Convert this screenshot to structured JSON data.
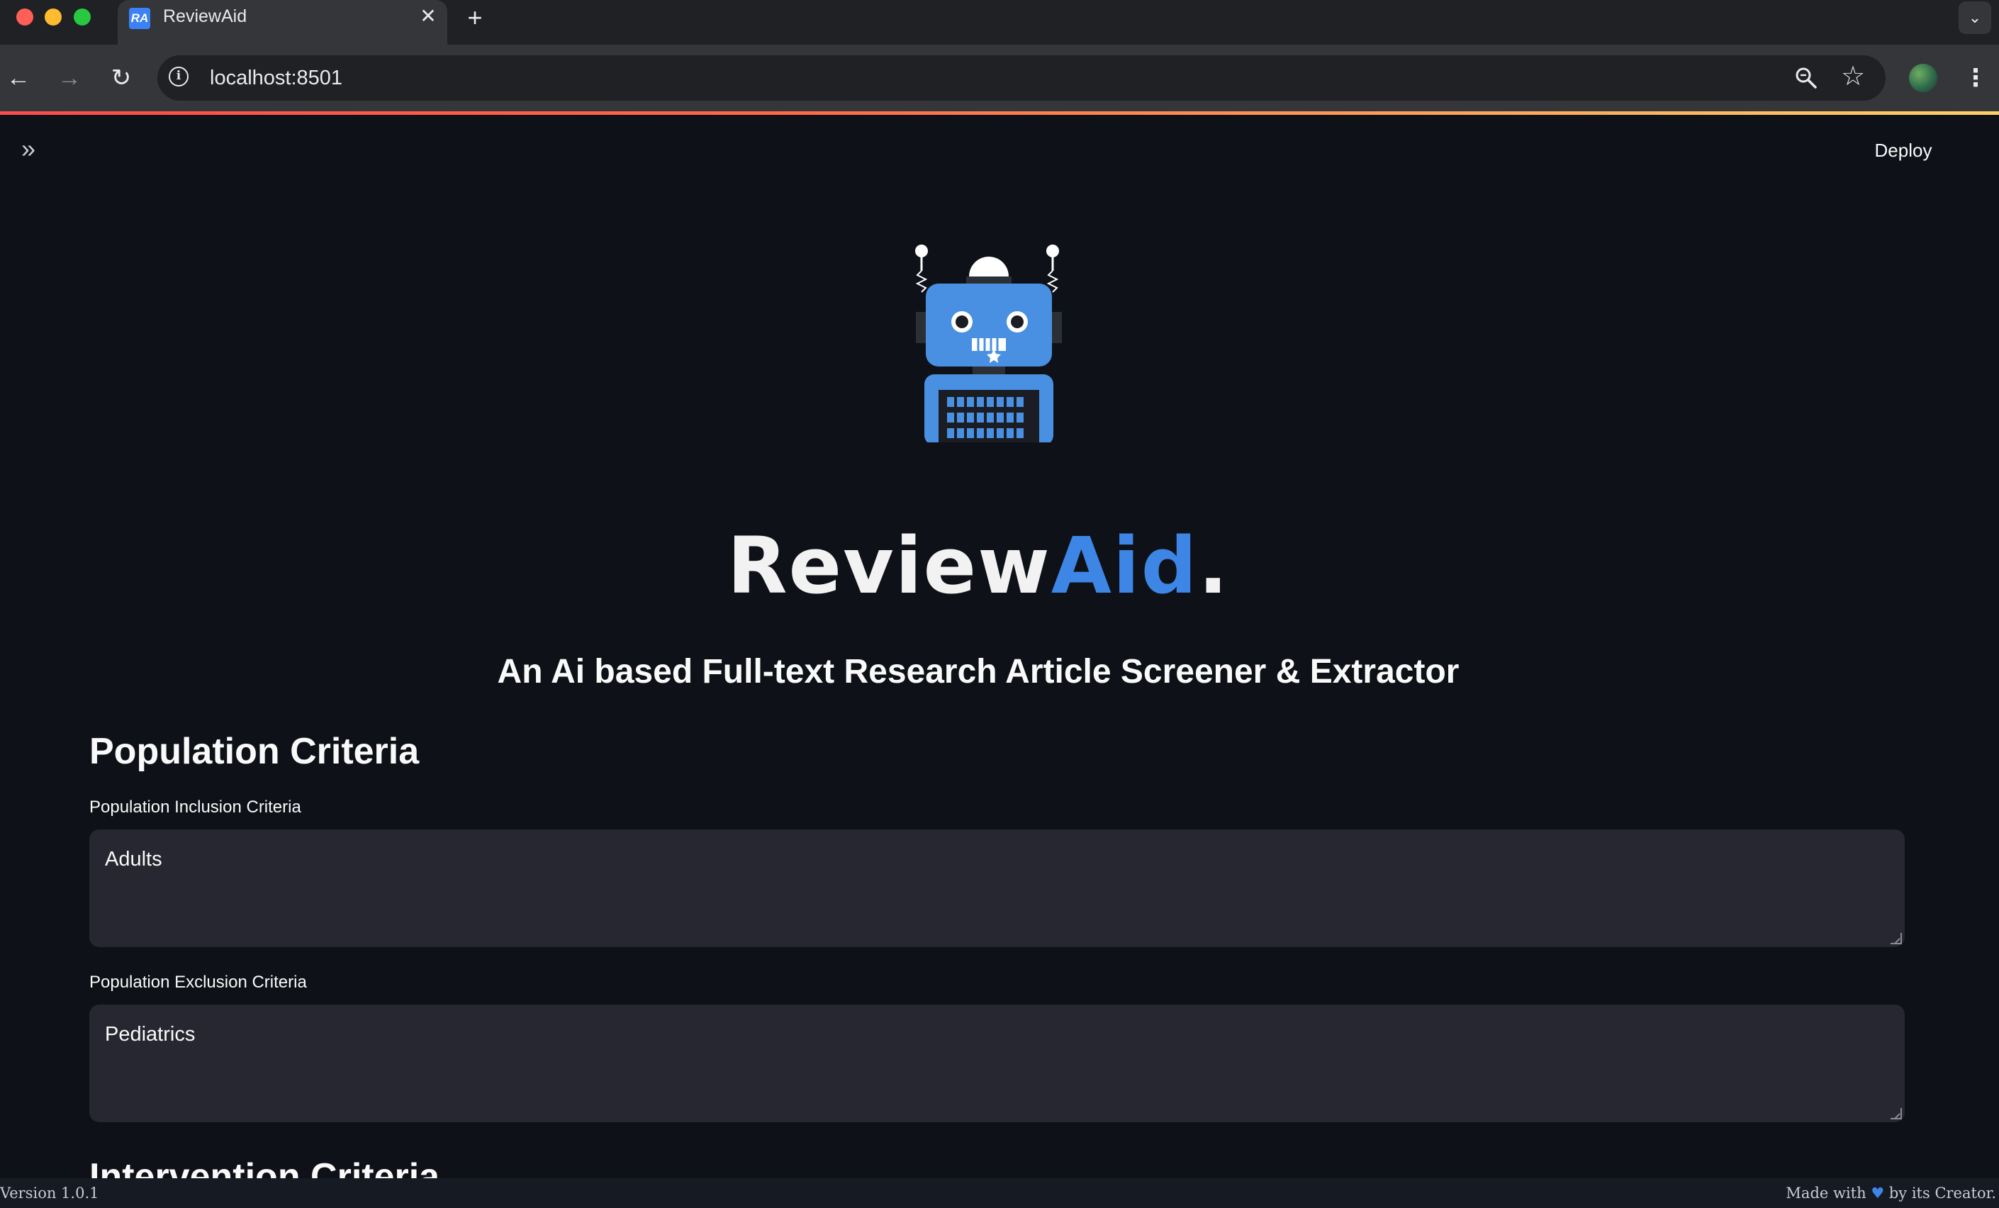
{
  "browser": {
    "tab_title": "ReviewAid",
    "favicon_text": "RA",
    "url": "localhost:8501",
    "icons": {
      "close": "close-icon",
      "new_tab": "plus-icon",
      "back": "arrow-left-icon",
      "forward": "arrow-right-icon",
      "reload": "reload-icon",
      "info": "info-icon",
      "zoom": "zoom-icon",
      "bookmark": "star-icon",
      "menu": "kebab-menu-icon"
    },
    "accent_colors": [
      "#ff4b4b",
      "#ffd166"
    ]
  },
  "app": {
    "deploy_label": "Deploy",
    "brand": {
      "part1": "Review",
      "part2": "Aid",
      "part3": ".",
      "accent_color": "#3d86e6"
    },
    "subtitle": "An Ai based Full-text Research Article Screener & Extractor",
    "sections": [
      {
        "heading": "Population Criteria",
        "fields": [
          {
            "label": "Population Inclusion Criteria",
            "value": "Adults"
          },
          {
            "label": "Population Exclusion Criteria",
            "value": "Pediatrics"
          }
        ]
      },
      {
        "heading": "Intervention Criteria"
      }
    ],
    "footer": {
      "version": "Version 1.0.1",
      "made_with_prefix": "Made with",
      "made_with_suffix": "by its Creator."
    }
  }
}
